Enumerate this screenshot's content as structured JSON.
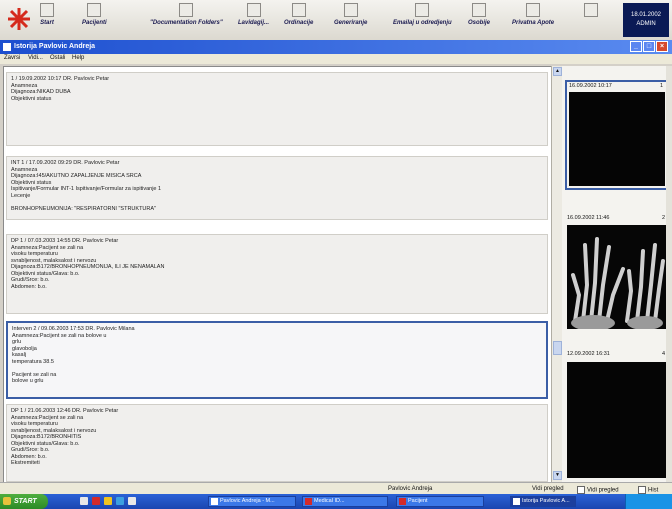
{
  "toolbar": {
    "buttons": [
      "Start",
      "Pacijenti",
      "\"Documentation Folders\"",
      "Lavidagij...",
      "Ordinacije",
      "Generiranje",
      "Emailaj u odredjenju",
      "Osobije",
      "Privatna Apote"
    ],
    "clock_date": "18.01.2002",
    "clock_user": "ADMIN"
  },
  "window": {
    "title": "Istorija Pavlovic Andreja"
  },
  "menu": [
    "Zavrsi",
    "Vidi...",
    "Ostali",
    "Help"
  ],
  "entries": [
    {
      "lines": [
        "1 / 19.09.2002 10:17 DR. Pavlovic Petar",
        "Anamneza",
        "Dijagnoza:NIKAD DUBA",
        "Objektivni status"
      ]
    },
    {
      "lines": [
        "INT 1 / 17.09.2002 09:29 DR. Pavlovic Petar",
        "Anamneza",
        "Dijagnoza:I45/AKUTNO ZAPALJENJE MISICA SRCA",
        "Objektivni status",
        "Ispitivanje/Formular INT-1 Ispitivanje/Formular za ispitivanje 1",
        "Lecenje",
        "",
        "BRONHOPNEUMONIJA:  \"RESPIRATORNI  \"STRUKTURA\""
      ]
    },
    {
      "lines": [
        "DP 1 / 07.03.2003 14:55 DR. Pavlovic Petar",
        "Anamneza:Pacijent se zali na",
        "visoku temperaturu",
        "svrabljenost, malaksalost i nervozu",
        "Dijagnoza:B172/BRONHOPNEUMONIJA, ILI JE NENAMALAN",
        "Objektivni status/Glava: b.o.",
        "Grudi/Srce: b.o.",
        "Abdomen: b.o."
      ]
    },
    {
      "lines": [
        "Interven 2 / 09.06.2003 17:53 DR. Pavlovic Milana",
        "Anamneza:Pacijent se zali na bolove u",
        "grlu",
        "glavobolja",
        "kasalj",
        "temperatura 38.5",
        "",
        "Pacijent se zali na",
        "bolove u grlu"
      ]
    },
    {
      "lines": [
        "DP 1 / 21.06.2003 12:46 DR. Pavlovic Petar",
        "Anamneza:Pacijent se zali na",
        "visoku temperaturu",
        "svrabljenost, malaksalost i nervozu",
        "Dijagnoza:B172/BRONHITIS",
        "Objektivni status/Glava: b.o.",
        "Grudi/Srce: b.o.",
        "Abdomen: b.o.",
        "Ekstremiteti"
      ]
    }
  ],
  "thumbnails": [
    {
      "date": "16.09.2002 10:17",
      "num": "1"
    },
    {
      "date": "16.09.2002 11:46",
      "num": "2"
    },
    {
      "date": "12.09.2002 16:31",
      "num": "4"
    }
  ],
  "status": {
    "patient": "Pavlovic Andreja",
    "option1": "Vidi pregled",
    "option2": "Vidi pregled",
    "option3": "Hist"
  },
  "taskbar": {
    "start": "START",
    "tasks": [
      "Pavlovic Andreja - M...",
      "Medical ID...",
      "Pacijent",
      "Istorija Pavlovic A..."
    ]
  }
}
